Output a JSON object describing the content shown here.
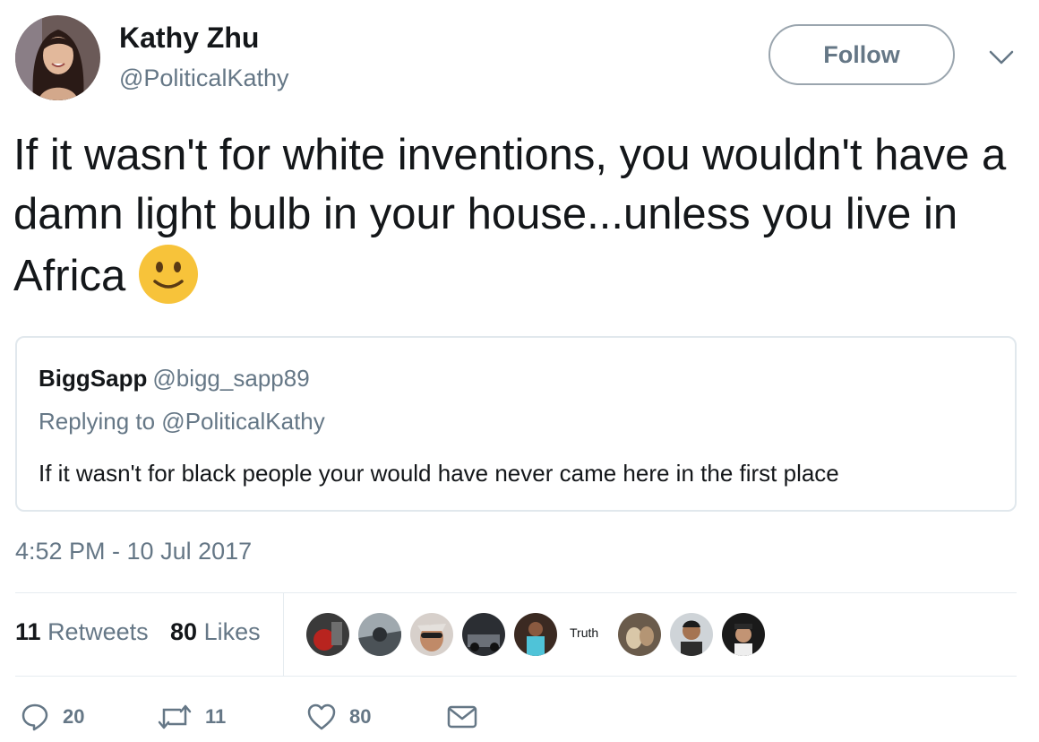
{
  "author": {
    "name": "Kathy Zhu",
    "handle": "@PoliticalKathy"
  },
  "follow_label": "Follow",
  "tweet": {
    "text": "If it wasn't for white inventions, you wouldn't have a damn light bulb in your house...unless you live in Africa",
    "emoji": "slightly-smiling-face"
  },
  "quote": {
    "name": "BiggSapp",
    "handle": "@bigg_sapp89",
    "replying_to": "Replying to @PoliticalKathy",
    "text": "If it wasn't  for black people your would have never came here in the first place"
  },
  "timestamp": "4:52 PM - 10 Jul 2017",
  "stats": {
    "retweets_count": "11",
    "retweets_label": "Retweets",
    "likes_count": "80",
    "likes_label": "Likes"
  },
  "likers": {
    "truth_label": "Truth"
  },
  "actions": {
    "reply_count": "20",
    "retweet_count": "11",
    "like_count": "80"
  },
  "colors": {
    "text": "#14171a",
    "secondary": "#657786",
    "border": "#e1e8ed",
    "emoji": "#f7c33a"
  }
}
